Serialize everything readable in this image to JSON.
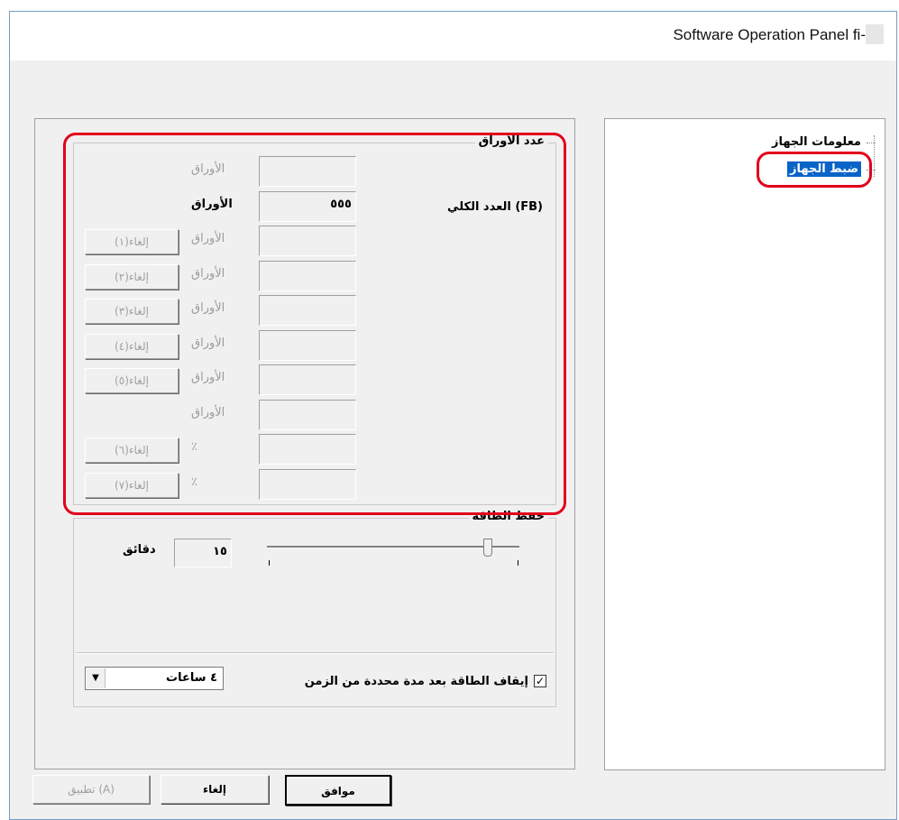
{
  "window": {
    "title": "Software Operation Panel fi-"
  },
  "tree": {
    "items": [
      {
        "label": "معلومات الجهاز"
      },
      {
        "label": "ضبط الجهاز",
        "selected": true
      }
    ]
  },
  "sheet_count": {
    "legend": "عدد الأوراق",
    "total_label": "العدد الكلي (FB)",
    "rows": [
      {
        "unit": "الأوراق",
        "value": "",
        "enabled": false,
        "button": ""
      },
      {
        "unit": "الأوراق",
        "value": "٥٥٥",
        "enabled": true,
        "button": ""
      },
      {
        "unit": "الأوراق",
        "value": "",
        "enabled": false,
        "button": "إلغاء(١)"
      },
      {
        "unit": "الأوراق",
        "value": "",
        "enabled": false,
        "button": "إلغاء(٢)"
      },
      {
        "unit": "الأوراق",
        "value": "",
        "enabled": false,
        "button": "إلغاء(٣)"
      },
      {
        "unit": "الأوراق",
        "value": "",
        "enabled": false,
        "button": "إلغاء(٤)"
      },
      {
        "unit": "الأوراق",
        "value": "",
        "enabled": false,
        "button": "إلغاء(٥)"
      },
      {
        "unit": "الأوراق",
        "value": "",
        "enabled": false,
        "button": ""
      },
      {
        "unit": "٪",
        "value": "",
        "enabled": false,
        "button": "إلغاء(٦)"
      },
      {
        "unit": "٪",
        "value": "",
        "enabled": false,
        "button": "إلغاء(٧)"
      }
    ]
  },
  "power_saving": {
    "legend": "حفظ الطاقة",
    "minutes_value": "١٥",
    "minutes_unit": "دقائق",
    "slider_level_fraction": 1.0,
    "auto_off_label": "إيقاف الطاقة بعد مدة محددة من الزمن",
    "auto_off_checked": true,
    "check_mark": "✓",
    "hours_selected": "٤ ساعات",
    "dropdown_arrow": "▼"
  },
  "buttons": {
    "ok": "موافق",
    "cancel": "إلغاء",
    "apply": "تطبيق (A)"
  },
  "colors": {
    "highlight": "#e2001a",
    "selection": "#0a64c8"
  }
}
